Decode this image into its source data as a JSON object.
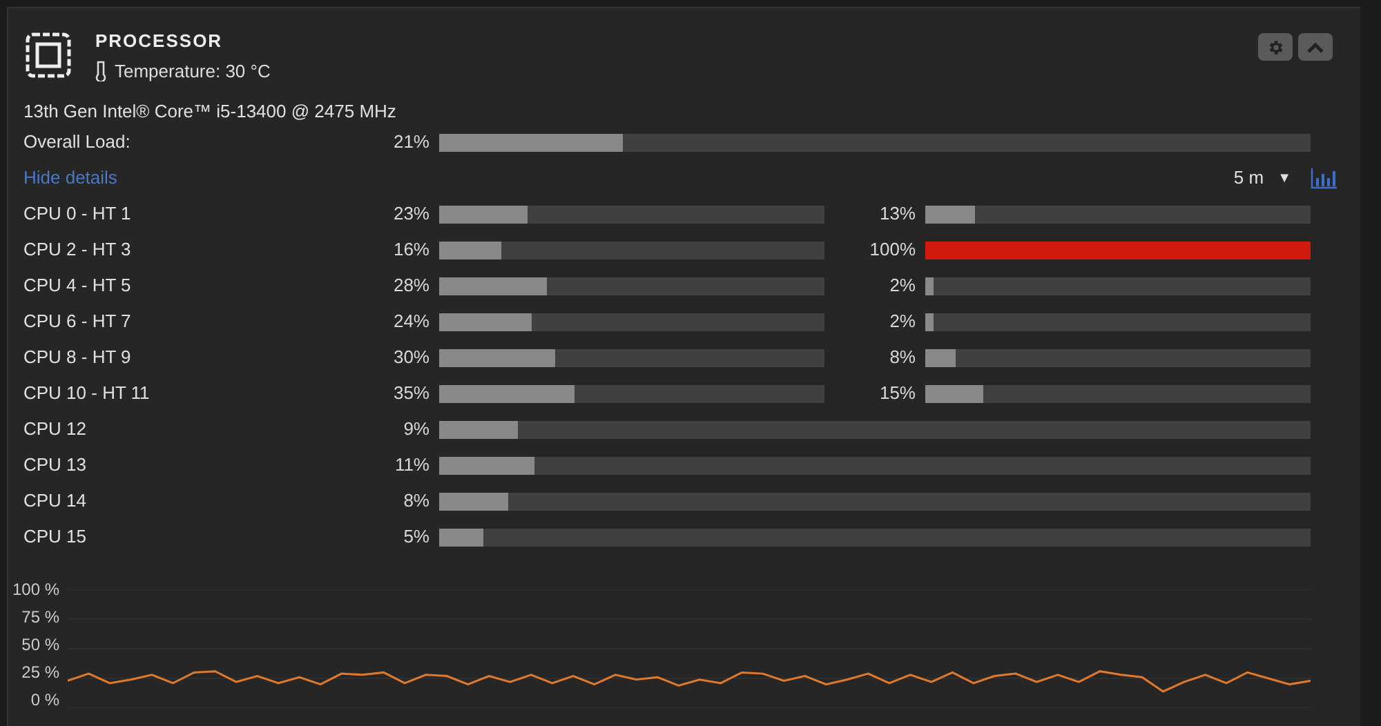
{
  "header": {
    "title": "PROCESSOR",
    "temperature": "Temperature: 30 °C"
  },
  "cpu_name": "13th Gen Intel® Core™ i5-13400 @ 2475 MHz",
  "overall": {
    "label": "Overall Load:",
    "reading": "21%",
    "level": 0.21
  },
  "details_link": "Hide details",
  "range": {
    "value": "5 m",
    "caret": "▼"
  },
  "cores": [
    {
      "label": "CPU 0 - HT 1",
      "meters": [
        {
          "reading": "23%",
          "level": 0.23
        },
        {
          "reading": "13%",
          "level": 0.13
        }
      ]
    },
    {
      "label": "CPU 2 - HT 3",
      "meters": [
        {
          "reading": "16%",
          "level": 0.16
        },
        {
          "reading": "100%",
          "level": 1
        }
      ]
    },
    {
      "label": "CPU 4 - HT 5",
      "meters": [
        {
          "reading": "28%",
          "level": 0.28
        },
        {
          "reading": "2%",
          "level": 0.02
        }
      ]
    },
    {
      "label": "CPU 6 - HT 7",
      "meters": [
        {
          "reading": "24%",
          "level": 0.24
        },
        {
          "reading": "2%",
          "level": 0.02
        }
      ]
    },
    {
      "label": "CPU 8 - HT 9",
      "meters": [
        {
          "reading": "30%",
          "level": 0.3
        },
        {
          "reading": "8%",
          "level": 0.08
        }
      ]
    },
    {
      "label": "CPU 10 - HT 11",
      "meters": [
        {
          "reading": "35%",
          "level": 0.35
        },
        {
          "reading": "15%",
          "level": 0.15
        }
      ]
    },
    {
      "label": "CPU 12",
      "meters": [
        {
          "reading": "9%",
          "level": 0.09
        }
      ]
    },
    {
      "label": "CPU 13",
      "meters": [
        {
          "reading": "11%",
          "level": 0.11
        }
      ]
    },
    {
      "label": "CPU 14",
      "meters": [
        {
          "reading": "8%",
          "level": 0.08
        }
      ]
    },
    {
      "label": "CPU 15",
      "meters": [
        {
          "reading": "5%",
          "level": 0.05
        }
      ]
    }
  ],
  "chart_data": {
    "type": "line",
    "ylim": [
      0,
      100
    ],
    "yticks": [
      {
        "value": 0,
        "label": "0 %"
      },
      {
        "value": 25,
        "label": "25 %"
      },
      {
        "value": 50,
        "label": "50 %"
      },
      {
        "value": 75,
        "label": "75 %"
      },
      {
        "value": 100,
        "label": "100 %"
      }
    ],
    "grid": true,
    "series": [
      {
        "color": "#e07a2a",
        "values": [
          23,
          29,
          21,
          24,
          28,
          21,
          30,
          31,
          22,
          27,
          21,
          26,
          20,
          29,
          28,
          30,
          21,
          28,
          27,
          20,
          27,
          22,
          28,
          21,
          27,
          20,
          28,
          24,
          26,
          19,
          24,
          21,
          30,
          29,
          23,
          27,
          20,
          24,
          29,
          21,
          28,
          22,
          30,
          21,
          27,
          29,
          22,
          28,
          22,
          31,
          28,
          26,
          14,
          22,
          28,
          21,
          30,
          25,
          20,
          23
        ]
      }
    ]
  }
}
